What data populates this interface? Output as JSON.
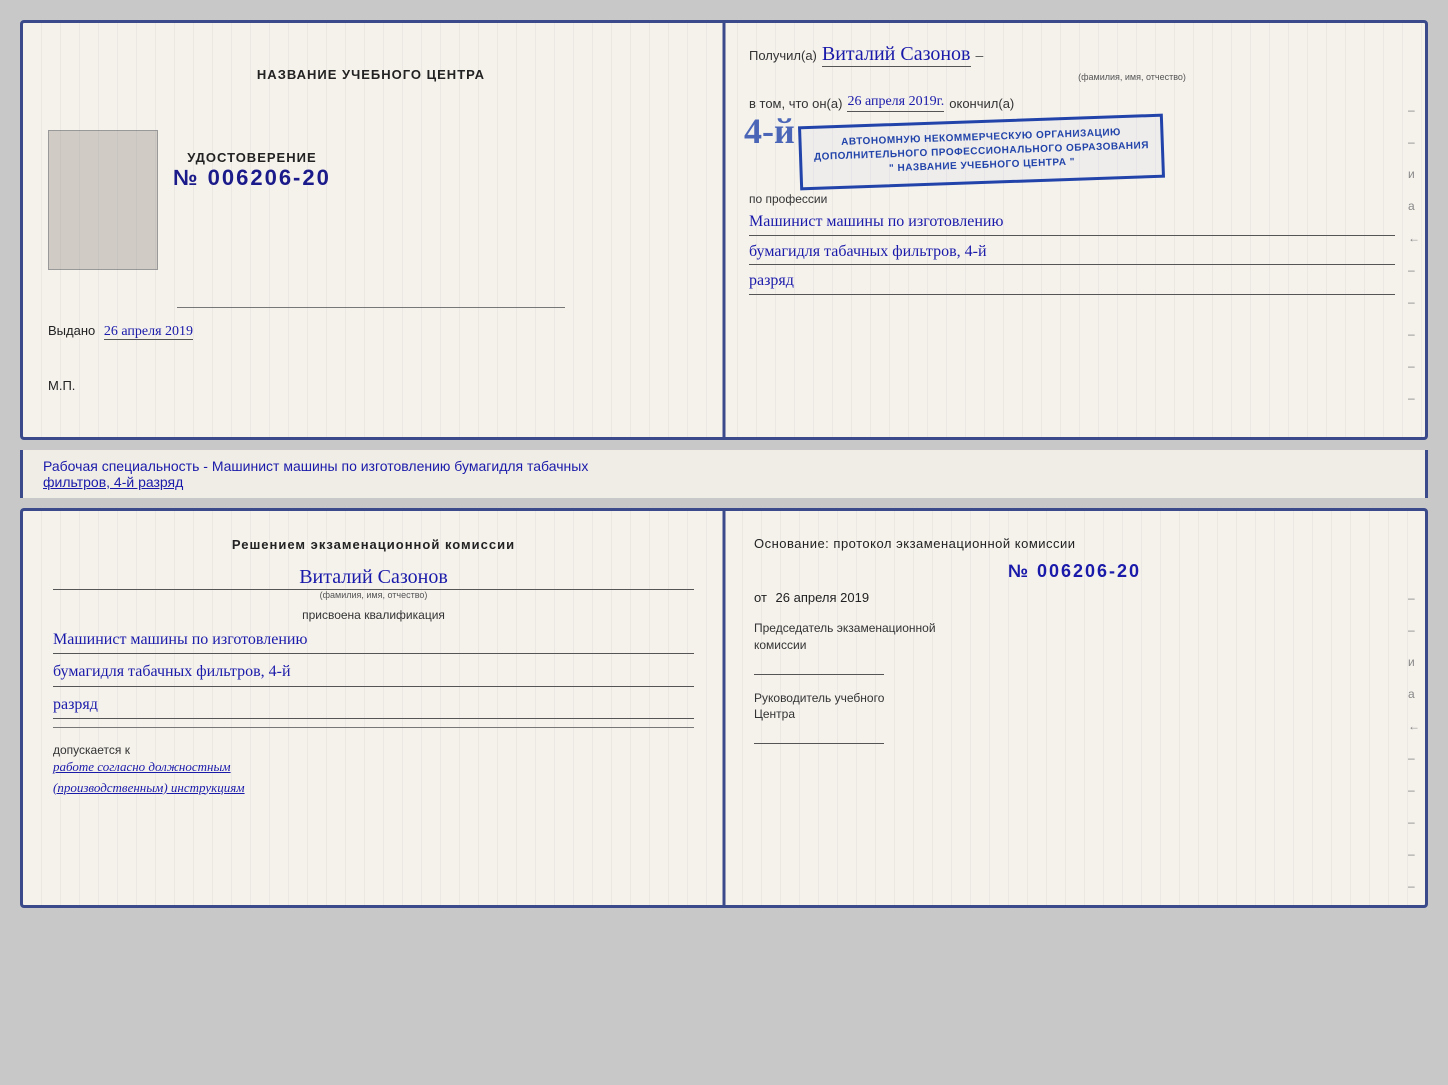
{
  "page": {
    "background": "#c8c8c8"
  },
  "top_cert": {
    "left": {
      "title_label": "НАЗВАНИЕ УЧЕБНОГО ЦЕНТРА",
      "cert_label": "УДОСТОВЕРЕНИЕ",
      "cert_number": "№ 006206-20",
      "issued_label": "Выдано",
      "issued_date": "26 апреля 2019",
      "mp_label": "М.П."
    },
    "right": {
      "received_label": "Получил(а)",
      "recipient_name": "Виталий Сазонов",
      "fio_hint": "(фамилия, имя, отчество)",
      "dash": "–",
      "vtom_label": "в том, что он(а)",
      "date_handwritten": "26 апреля 2019г.",
      "okonchil_label": "окончил(а)",
      "stamp_number": "4-й",
      "stamp_line1": "АВТОНОМНУЮ НЕКОММЕРЧЕСКУЮ ОРГАНИЗАЦИЮ",
      "stamp_line2": "ДОПОЛНИТЕЛЬНОГО ПРОФЕССИОНАЛЬНОГО ОБРАЗОВАНИЯ",
      "stamp_line3": "\" НАЗВАНИЕ УЧЕБНОГО ЦЕНТРА \"",
      "i_label": "и",
      "a_label": "а",
      "arrow_label": "←",
      "profession_label": "по профессии",
      "profession_line1": "Машинист машины по изготовлению",
      "profession_line2": "бумагидля табачных фильтров, 4-й",
      "profession_line3": "разряд"
    }
  },
  "middle": {
    "text": "Рабочая специальность - Машинист машины по изготовлению бумагидля табачных",
    "text2": "фильтров, 4-й разряд"
  },
  "bottom_cert": {
    "left": {
      "decision_title": "Решением  экзаменационной  комиссии",
      "person_name": "Виталий Сазонов",
      "fio_hint": "(фамилия, имя, отчество)",
      "qualification_label": "присвоена квалификация",
      "qual_line1": "Машинист машины по изготовлению",
      "qual_line2": "бумагидля табачных фильтров, 4-й",
      "qual_line3": "разряд",
      "допускается_label": "допускается к",
      "допускается_text": "работе согласно должностным",
      "допускается_text2": "(производственным) инструкциям"
    },
    "right": {
      "osnov_text": "Основание: протокол экзаменационной  комиссии",
      "protocol_num": "№  006206-20",
      "ot_label": "от",
      "ot_date": "26 апреля 2019",
      "chairman_label": "Председатель экзаменационной",
      "chairman_label2": "комиссии",
      "director_label": "Руководитель учебного",
      "director_label2": "Центра",
      "i_label": "и",
      "a_label": "а",
      "arrow_label": "←"
    }
  }
}
